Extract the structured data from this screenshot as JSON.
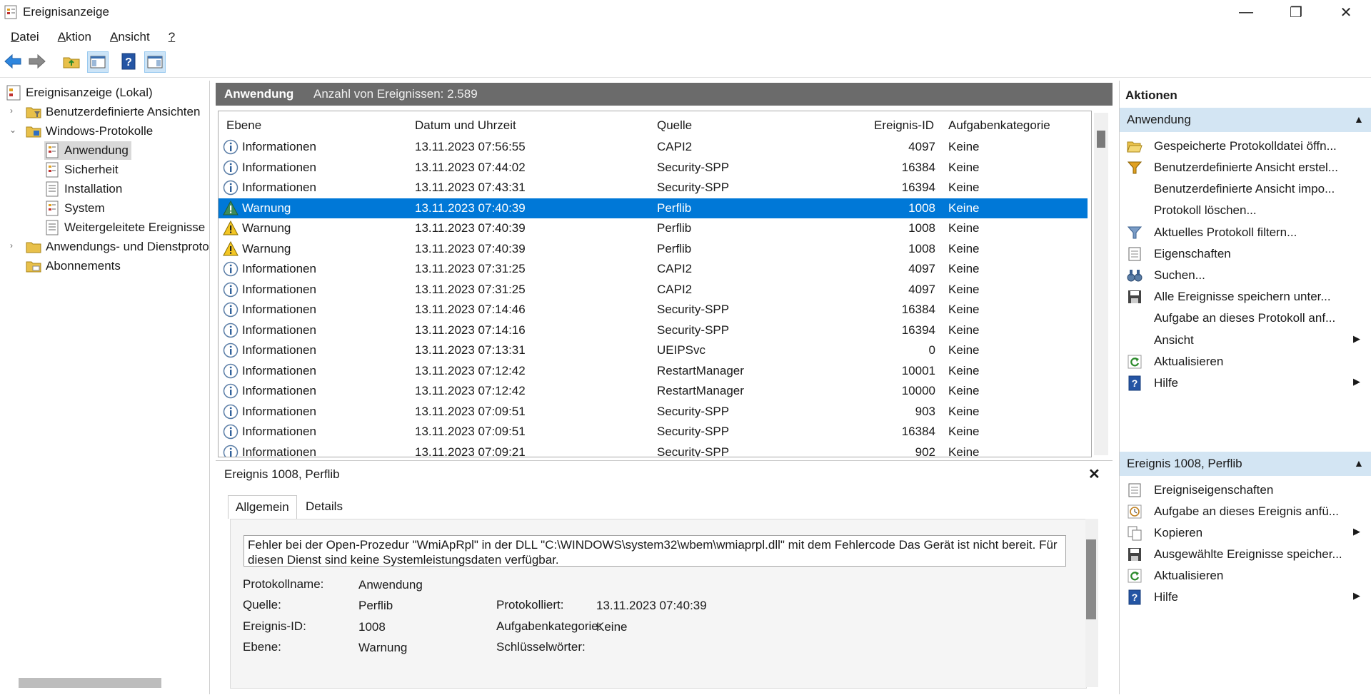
{
  "window": {
    "title": "Ereignisanzeige",
    "minimize": "—",
    "maximize": "❐",
    "close": "✕"
  },
  "menu": [
    {
      "label": "Datei",
      "accel": "D",
      "rest": "atei"
    },
    {
      "label": "Aktion",
      "accel": "A",
      "rest": "ktion"
    },
    {
      "label": "Ansicht",
      "accel": "A",
      "rest": "nsicht"
    },
    {
      "label": "?",
      "accel": "?",
      "rest": ""
    }
  ],
  "tree": {
    "root": "Ereignisanzeige (Lokal)",
    "items": [
      "Benutzerdefinierte Ansichten",
      "Windows-Protokolle",
      "Anwendung",
      "Sicherheit",
      "Installation",
      "System",
      "Weitergeleitete Ereignisse",
      "Anwendungs- und Dienstprotokolle",
      "Abonnements"
    ]
  },
  "center": {
    "title": "Anwendung",
    "count": "Anzahl von Ereignissen: 2.589"
  },
  "columns": [
    "Ebene",
    "Datum und Uhrzeit",
    "Quelle",
    "Ereignis-ID",
    "Aufgabenkategorie"
  ],
  "events": [
    {
      "level": "Informationen",
      "type": "info",
      "date": "13.11.2023 07:56:55",
      "source": "CAPI2",
      "id": "4097",
      "category": "Keine"
    },
    {
      "level": "Informationen",
      "type": "info",
      "date": "13.11.2023 07:44:02",
      "source": "Security-SPP",
      "id": "16384",
      "category": "Keine"
    },
    {
      "level": "Informationen",
      "type": "info",
      "date": "13.11.2023 07:43:31",
      "source": "Security-SPP",
      "id": "16394",
      "category": "Keine"
    },
    {
      "level": "Warnung",
      "type": "warn",
      "date": "13.11.2023 07:40:39",
      "source": "Perflib",
      "id": "1008",
      "category": "Keine"
    },
    {
      "level": "Warnung",
      "type": "warn",
      "date": "13.11.2023 07:40:39",
      "source": "Perflib",
      "id": "1008",
      "category": "Keine"
    },
    {
      "level": "Warnung",
      "type": "warn",
      "date": "13.11.2023 07:40:39",
      "source": "Perflib",
      "id": "1008",
      "category": "Keine"
    },
    {
      "level": "Informationen",
      "type": "info",
      "date": "13.11.2023 07:31:25",
      "source": "CAPI2",
      "id": "4097",
      "category": "Keine"
    },
    {
      "level": "Informationen",
      "type": "info",
      "date": "13.11.2023 07:31:25",
      "source": "CAPI2",
      "id": "4097",
      "category": "Keine"
    },
    {
      "level": "Informationen",
      "type": "info",
      "date": "13.11.2023 07:14:46",
      "source": "Security-SPP",
      "id": "16384",
      "category": "Keine"
    },
    {
      "level": "Informationen",
      "type": "info",
      "date": "13.11.2023 07:14:16",
      "source": "Security-SPP",
      "id": "16394",
      "category": "Keine"
    },
    {
      "level": "Informationen",
      "type": "info",
      "date": "13.11.2023 07:13:31",
      "source": "UEIPSvc",
      "id": "0",
      "category": "Keine"
    },
    {
      "level": "Informationen",
      "type": "info",
      "date": "13.11.2023 07:12:42",
      "source": "RestartManager",
      "id": "10001",
      "category": "Keine"
    },
    {
      "level": "Informationen",
      "type": "info",
      "date": "13.11.2023 07:12:42",
      "source": "RestartManager",
      "id": "10000",
      "category": "Keine"
    },
    {
      "level": "Informationen",
      "type": "info",
      "date": "13.11.2023 07:09:51",
      "source": "Security-SPP",
      "id": "903",
      "category": "Keine"
    },
    {
      "level": "Informationen",
      "type": "info",
      "date": "13.11.2023 07:09:51",
      "source": "Security-SPP",
      "id": "16384",
      "category": "Keine"
    },
    {
      "level": "Informationen",
      "type": "info",
      "date": "13.11.2023 07:09:21",
      "source": "Security-SPP",
      "id": "902",
      "category": "Keine"
    }
  ],
  "selected_index": 3,
  "detail": {
    "title": "Ereignis 1008, Perflib",
    "tabs": [
      "Allgemein",
      "Details"
    ],
    "message": "Fehler bei der Open-Prozedur \"WmiApRpl\" in der DLL \"C:\\WINDOWS\\system32\\wbem\\wmiaprpl.dll\" mit dem Fehlercode Das Gerät ist nicht bereit. Für diesen Dienst sind keine Systemleistungsdaten verfügbar.",
    "fields": {
      "log_name_label": "Protokollname:",
      "log_name_value": "Anwendung",
      "source_label": "Quelle:",
      "source_value": "Perflib",
      "logged_label": "Protokolliert:",
      "logged_value": "13.11.2023 07:40:39",
      "event_id_label": "Ereignis-ID:",
      "event_id_value": "1008",
      "task_label": "Aufgabenkategorie:",
      "task_value": "Keine",
      "level_label": "Ebene:",
      "level_value": "Warnung",
      "keywords_label": "Schlüsselwörter:"
    }
  },
  "actions": {
    "title": "Aktionen",
    "section1": "Anwendung",
    "items1": [
      {
        "label": "Gespeicherte Protokolldatei öffn...",
        "icon": "folder-open-icon"
      },
      {
        "label": "Benutzerdefinierte Ansicht erstel...",
        "icon": "filter-create-icon"
      },
      {
        "label": "Benutzerdefinierte Ansicht impo...",
        "icon": ""
      },
      {
        "label": "Protokoll löschen...",
        "icon": ""
      },
      {
        "label": "Aktuelles Protokoll filtern...",
        "icon": "filter-icon"
      },
      {
        "label": "Eigenschaften",
        "icon": "properties-icon"
      },
      {
        "label": "Suchen...",
        "icon": "binoculars-icon"
      },
      {
        "label": "Alle Ereignisse speichern unter...",
        "icon": "save-icon"
      },
      {
        "label": "Aufgabe an dieses Protokoll anf...",
        "icon": ""
      },
      {
        "label": "Ansicht",
        "icon": "",
        "submenu": true
      },
      {
        "label": "Aktualisieren",
        "icon": "refresh-icon"
      },
      {
        "label": "Hilfe",
        "icon": "help-icon",
        "submenu": true
      }
    ],
    "section2": "Ereignis 1008, Perflib",
    "items2": [
      {
        "label": "Ereigniseigenschaften",
        "icon": "properties-icon"
      },
      {
        "label": "Aufgabe an dieses Ereignis anfü...",
        "icon": "task-icon"
      },
      {
        "label": "Kopieren",
        "icon": "copy-icon",
        "submenu": true
      },
      {
        "label": "Ausgewählte Ereignisse speicher...",
        "icon": "save-icon"
      },
      {
        "label": "Aktualisieren",
        "icon": "refresh-icon"
      },
      {
        "label": "Hilfe",
        "icon": "help-icon",
        "submenu": true
      }
    ]
  }
}
